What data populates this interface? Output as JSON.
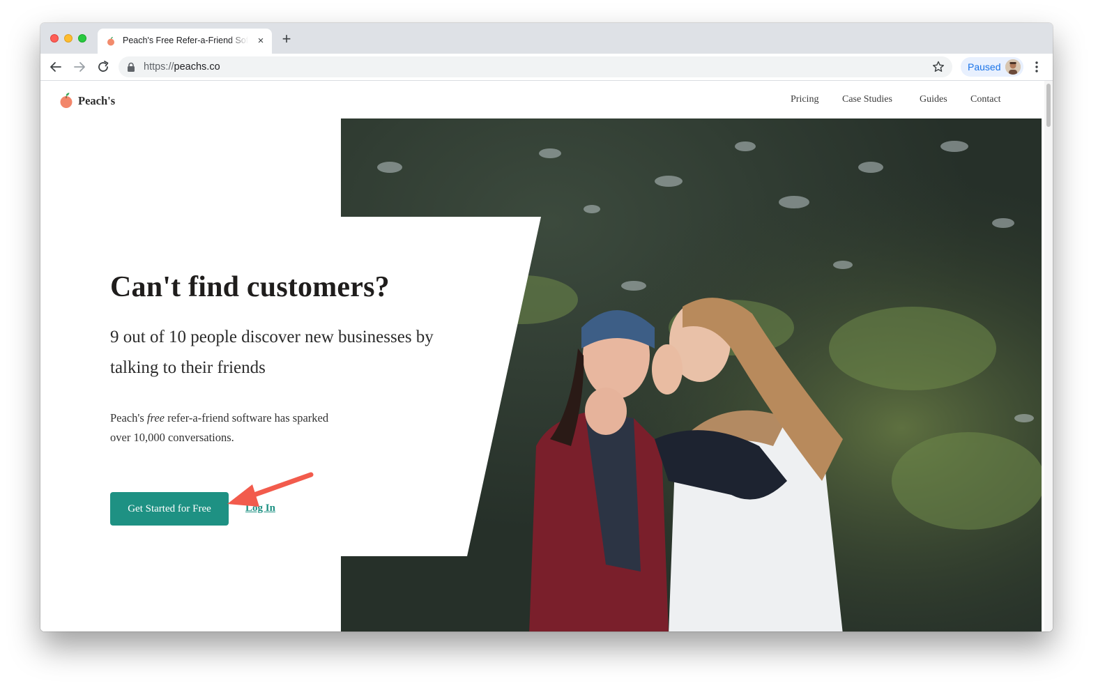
{
  "browser": {
    "tab_title": "Peach's Free Refer-a-Friend Software",
    "tab_close_glyph": "×",
    "new_tab_glyph": "+",
    "url_scheme": "https://",
    "url_host": "peachs.co",
    "profile_label": "Paused",
    "icons": [
      "back-arrow-icon",
      "forward-arrow-icon",
      "reload-icon",
      "lock-icon",
      "bookmark-star-icon",
      "kebab-menu-icon"
    ]
  },
  "site": {
    "brand": "Peach's",
    "nav": [
      "Pricing",
      "Case Studies",
      "Guides",
      "Contact"
    ]
  },
  "hero": {
    "headline": "Can't find customers?",
    "subhead": "9 out of 10 people discover new businesses by talking to their friends",
    "body_prefix": "Peach's ",
    "body_emphasis": "free",
    "body_suffix": " refer-a-friend software has sparked over 10,000 conversations.",
    "cta_label": "Get Started for Free",
    "login_label": "Log In"
  },
  "colors": {
    "accent": "#1e9183",
    "annotation_arrow": "#f25b4c",
    "photo_foliage": "#2f3a2e"
  }
}
